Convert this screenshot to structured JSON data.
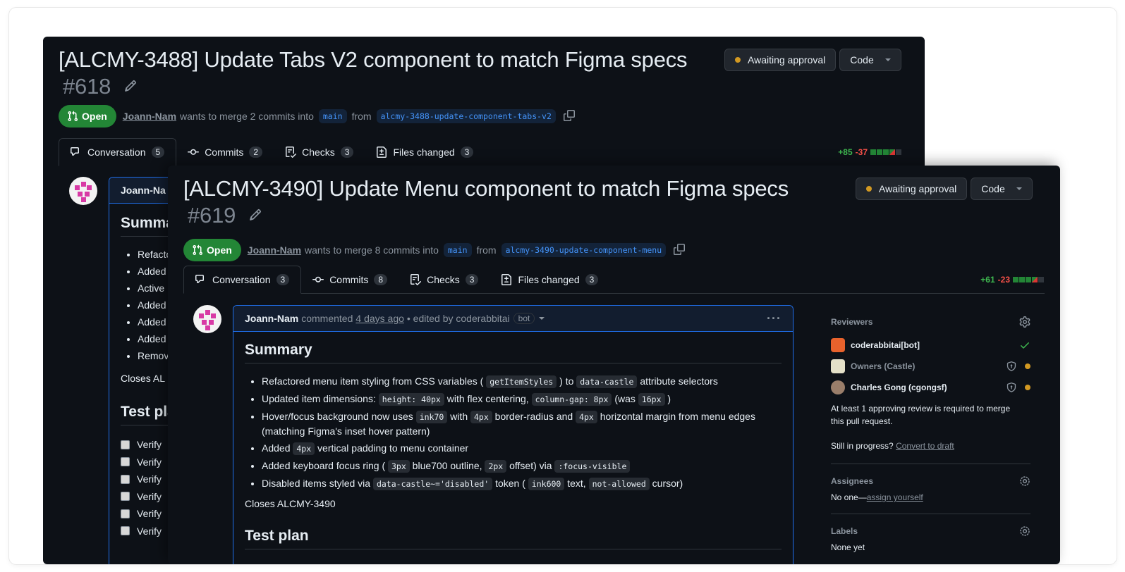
{
  "back": {
    "title": "[ALCMY-3488] Update Tabs V2 component to match Figma specs",
    "number": "#618",
    "status_label": "Awaiting approval",
    "code_label": "Code",
    "state": "Open",
    "author": "Joann-Nam",
    "merge_text": "wants to merge 2 commits into",
    "base_branch": "main",
    "from_text": "from",
    "head_branch": "alcmy-3488-update-component-tabs-v2",
    "tabs": [
      {
        "label": "Conversation",
        "count": "5"
      },
      {
        "label": "Commits",
        "count": "2"
      },
      {
        "label": "Checks",
        "count": "3"
      },
      {
        "label": "Files changed",
        "count": "3"
      }
    ],
    "additions": "+85",
    "deletions": "-37",
    "comment_author": "Joann-Na",
    "summary_heading": "Summa",
    "bullets": [
      "Refacto",
      "Added",
      "Active",
      "Added",
      "Added",
      "Added",
      "Remov"
    ],
    "closes": "Closes AL",
    "test_heading": "Test pla",
    "checks": [
      "Verify",
      "Verify",
      "Verify",
      "Verify",
      "Verify",
      "Verify"
    ]
  },
  "front": {
    "title": "[ALCMY-3490] Update Menu component to match Figma specs",
    "number": "#619",
    "status_label": "Awaiting approval",
    "code_label": "Code",
    "state": "Open",
    "author": "Joann-Nam",
    "merge_text": "wants to merge 8 commits into",
    "base_branch": "main",
    "from_text": "from",
    "head_branch": "alcmy-3490-update-component-menu",
    "tabs": [
      {
        "label": "Conversation",
        "count": "3"
      },
      {
        "label": "Commits",
        "count": "8"
      },
      {
        "label": "Checks",
        "count": "3"
      },
      {
        "label": "Files changed",
        "count": "3"
      }
    ],
    "additions": "+61",
    "deletions": "-23",
    "comment": {
      "author": "Joann-Nam",
      "action": "commented",
      "time": "4 days ago",
      "edited": "• edited by coderabbitai",
      "bot_badge": "bot",
      "more": "···"
    },
    "summary_heading": "Summary",
    "bullets": {
      "b1": {
        "t1": "Refactored menu item styling from CSS variables (",
        "c1": "getItemStyles",
        "t2": ") to",
        "c2": "data-castle",
        "t3": "attribute selectors"
      },
      "b2": {
        "t1": "Updated item dimensions:",
        "c1": "height: 40px",
        "t2": "with flex centering,",
        "c2": "column-gap: 8px",
        "t3": "(was",
        "c3": "16px",
        "t4": ")"
      },
      "b3": {
        "t1": "Hover/focus background now uses",
        "c1": "ink70",
        "t2": "with",
        "c2": "4px",
        "t3": "border-radius and",
        "c3": "4px",
        "t4": "horizontal margin from menu edges (matching Figma's inset hover pattern)"
      },
      "b4": {
        "t1": "Added",
        "c1": "4px",
        "t2": "vertical padding to menu container"
      },
      "b5": {
        "t1": "Added keyboard focus ring (",
        "c1": "3px",
        "t2": "blue700 outline,",
        "c2": "2px",
        "t3": "offset) via",
        "c3": ":focus-visible"
      },
      "b6": {
        "t1": "Disabled items styled via",
        "c1": "data-castle~='disabled'",
        "t2": "token (",
        "c2": "ink600",
        "t3": "text,",
        "c3": "not-allowed",
        "t4": "cursor)"
      }
    },
    "closes": "Closes ALCMY-3490",
    "test_heading": "Test plan",
    "sidebar": {
      "reviewers_heading": "Reviewers",
      "reviewers": [
        {
          "name": "coderabbitai[bot]",
          "status": "approved"
        },
        {
          "name": "Owners (Castle)",
          "status": "pending"
        },
        {
          "name": "Charles Gong (cgongsf)",
          "status": "pending"
        }
      ],
      "approval_note": "At least 1 approving review is required to merge this pull request.",
      "progress_text": "Still in progress?",
      "draft_link": "Convert to draft",
      "assignees_heading": "Assignees",
      "assignees_text": "No one—",
      "assign_link": "assign yourself",
      "labels_heading": "Labels",
      "labels_text": "None yet"
    }
  },
  "colors": {
    "bg": "#0d1117",
    "open_green": "#238636",
    "pending_dot": "#d29922",
    "link_blue": "#4493f8"
  }
}
